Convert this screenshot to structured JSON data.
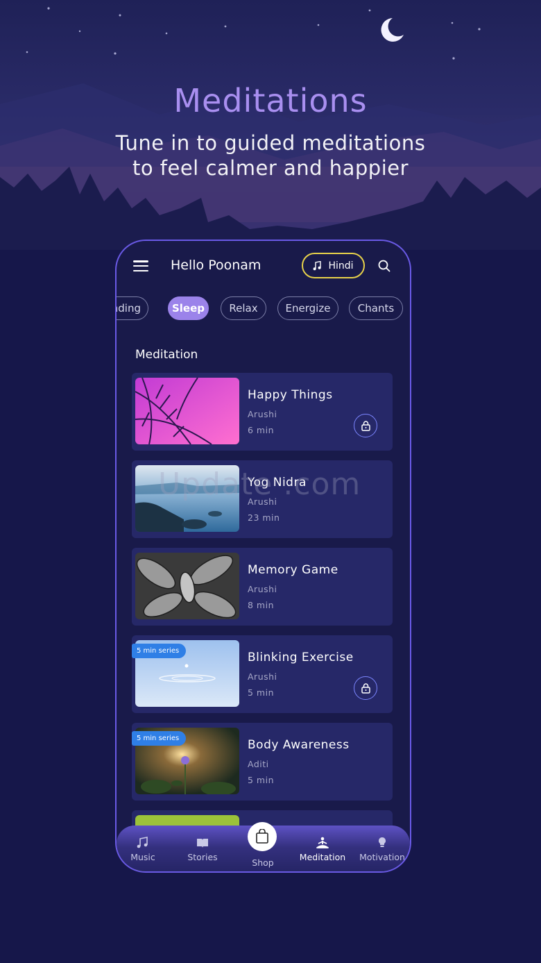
{
  "promo": {
    "title": "Meditations",
    "subtitle_line1": "Tune in to guided meditations",
    "subtitle_line2": "to feel calmer and happier"
  },
  "header": {
    "greeting": "Hello Poonam",
    "language_label": "Hindi"
  },
  "categories": [
    "nding",
    "Sleep",
    "Relax",
    "Energize",
    "Chants"
  ],
  "active_category": "Sleep",
  "section_title": "Meditation",
  "items": [
    {
      "title": "Happy Things",
      "author": "Arushi",
      "duration": "6 min",
      "locked": true,
      "badge": ""
    },
    {
      "title": "Yog Nidra",
      "author": "Arushi",
      "duration": "23 min",
      "locked": false,
      "badge": ""
    },
    {
      "title": "Memory Game",
      "author": "Arushi",
      "duration": "8 min",
      "locked": false,
      "badge": ""
    },
    {
      "title": "Blinking Exercise",
      "author": "Arushi",
      "duration": "5 min",
      "locked": true,
      "badge": "5 min series"
    },
    {
      "title": "Body Awareness",
      "author": "Aditi",
      "duration": "5 min",
      "locked": false,
      "badge": "5 min series"
    }
  ],
  "watermark": "Update   .com",
  "nav": {
    "music": "Music",
    "stories": "Stories",
    "shop": "Shop",
    "meditation": "Meditation",
    "motivation": "Motivation"
  },
  "colors": {
    "accent": "#9b83ea",
    "background": "#16174a",
    "card": "#262868",
    "language_border": "#e8d24a",
    "badge": "#2f7fe6"
  }
}
